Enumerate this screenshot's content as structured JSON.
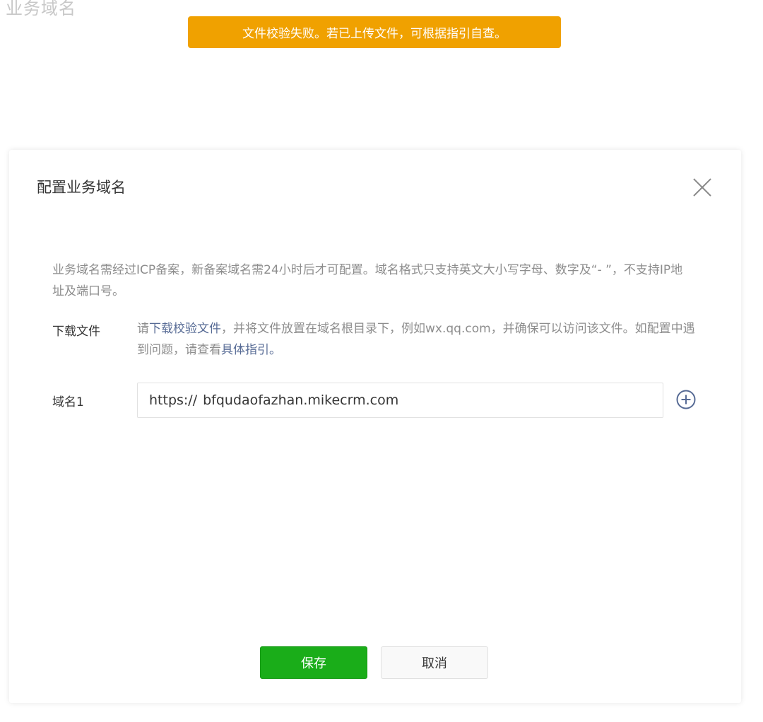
{
  "page": {
    "heading": "业务域名"
  },
  "toast": {
    "message": "文件校验失败。若已上传文件，可根据指引自查。",
    "color": "#f0a100"
  },
  "dialog": {
    "title": "配置业务域名",
    "close_icon": "close-icon",
    "description": "业务域名需经过ICP备案，新备案域名需24小时后才可配置。域名格式只支持英文大小写字母、数字及“- ”，不支持IP地址及端口号。",
    "download": {
      "label": "下载文件",
      "text_prefix": "请",
      "link_download": "下载校验文件",
      "text_middle": "，并将文件放置在域名根目录下，例如wx.qq.com，并确保可以访问该文件。如配置中遇到问题，请查看",
      "link_guide": "具体指引。"
    },
    "domain": {
      "label": "域名1",
      "prefix": "https://",
      "value": "bfqudaofazhan.mikecrm.com",
      "add_icon": "plus-circle-icon"
    },
    "buttons": {
      "save": "保存",
      "cancel": "取消"
    }
  },
  "colors": {
    "primary_green": "#1aad19",
    "link_blue": "#576b95",
    "warning_orange": "#f0a100"
  }
}
